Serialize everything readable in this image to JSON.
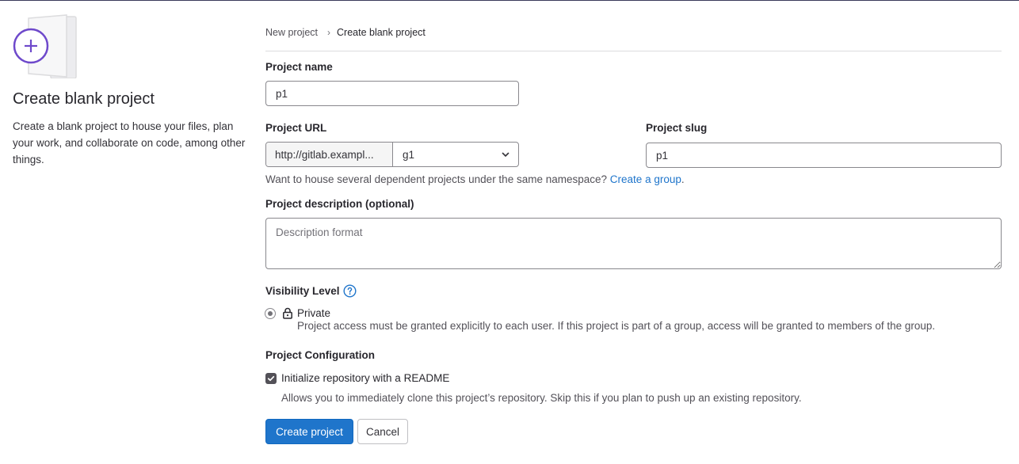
{
  "left": {
    "title": "Create blank project",
    "description": "Create a blank project to house your files, plan your work, and collaborate on code, among other things."
  },
  "breadcrumb": {
    "parent": "New project",
    "current": "Create blank project"
  },
  "form": {
    "project_name": {
      "label": "Project name",
      "value": "p1"
    },
    "project_url": {
      "label": "Project URL",
      "prefix": "http://gitlab.exampl...",
      "namespace": "g1"
    },
    "project_slug": {
      "label": "Project slug",
      "value": "p1"
    },
    "group_hint": {
      "text": "Want to house several dependent projects under the same namespace?",
      "link": "Create a group",
      "suffix": "."
    },
    "description": {
      "label": "Project description (optional)",
      "placeholder": "Description format",
      "value": ""
    },
    "visibility": {
      "label": "Visibility Level",
      "option": "Private",
      "help": "Project access must be granted explicitly to each user. If this project is part of a group, access will be granted to members of the group."
    },
    "config": {
      "label": "Project Configuration",
      "readme_label": "Initialize repository with a README",
      "readme_help": "Allows you to immediately clone this project’s repository. Skip this if you plan to push up an existing repository.",
      "readme_checked": true
    }
  },
  "actions": {
    "create": "Create project",
    "cancel": "Cancel"
  },
  "colors": {
    "primary": "#1f75cb",
    "illustration_purple": "#6e49cb",
    "link": "#1f75cb"
  }
}
